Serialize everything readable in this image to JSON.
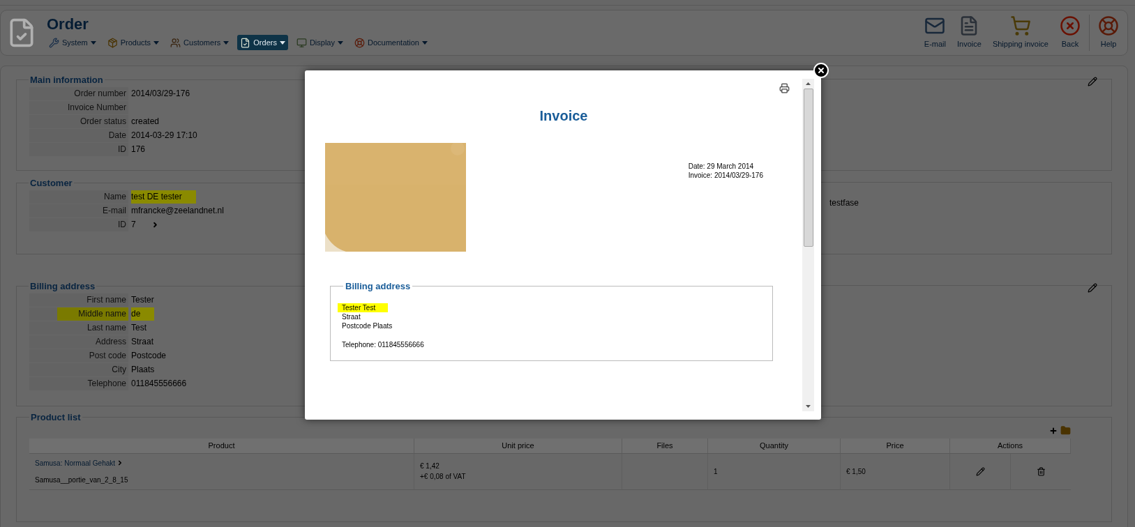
{
  "header": {
    "title": "Order",
    "menu": [
      {
        "label": "System",
        "selected": false
      },
      {
        "label": "Products",
        "selected": false
      },
      {
        "label": "Customers",
        "selected": false
      },
      {
        "label": "Orders",
        "selected": true
      },
      {
        "label": "Display",
        "selected": false
      },
      {
        "label": "Documentation",
        "selected": false
      }
    ],
    "toolbar": [
      "E-mail",
      "Invoice",
      "Shipping invoice",
      "Back",
      "Help"
    ]
  },
  "sections": [
    {
      "title": "Main information",
      "editable": true,
      "rows": [
        {
          "label": "Order number",
          "value": "2014/03/29-176",
          "kind": "text",
          "label_highlighted": false,
          "value_highlighted": false
        },
        {
          "label": "Invoice Number",
          "kind": "text",
          "label_highlighted": false
        },
        {
          "label": "Order status",
          "value": "created",
          "kind": "text",
          "label_highlighted": false,
          "value_highlighted": false
        },
        {
          "label": "Date",
          "value": "2014-03-29 17:10",
          "kind": "text",
          "label_highlighted": false,
          "value_highlighted": false
        },
        {
          "label": "ID",
          "value": "176",
          "kind": "text",
          "label_highlighted": false,
          "value_highlighted": false
        }
      ]
    },
    {
      "title": "Customer",
      "editable": false,
      "side_text": "testfase",
      "rows": [
        {
          "label": "Name",
          "value": "test DE tester",
          "kind": "text",
          "label_highlighted": false,
          "value_highlighted": true
        },
        {
          "label": "E-mail",
          "value": "mfrancke@zeelandnet.nl",
          "kind": "text",
          "label_highlighted": false,
          "value_highlighted": false
        },
        {
          "label": "ID",
          "value": "7",
          "kind": "link",
          "label_highlighted": false,
          "value_highlighted": false
        }
      ]
    },
    {
      "title": "Billing address",
      "editable": true,
      "rows": [
        {
          "label": "First name",
          "value": "Tester",
          "kind": "text",
          "label_highlighted": false,
          "value_highlighted": false
        },
        {
          "label": "Middle name",
          "value": "de",
          "kind": "text",
          "label_highlighted": true,
          "value_highlighted": true
        },
        {
          "label": "Last name",
          "value": "Test",
          "kind": "text",
          "label_highlighted": false,
          "value_highlighted": false
        },
        {
          "label": "Address",
          "value": "Straat",
          "kind": "text",
          "label_highlighted": false,
          "value_highlighted": false
        },
        {
          "label": "Post code",
          "value": "Postcode",
          "kind": "text",
          "label_highlighted": false,
          "value_highlighted": false
        },
        {
          "label": "City",
          "value": "Plaats",
          "kind": "text",
          "label_highlighted": false,
          "value_highlighted": false
        },
        {
          "label": "Telephone",
          "value": "011845556666",
          "kind": "text",
          "label_highlighted": false,
          "value_highlighted": false
        }
      ]
    }
  ],
  "product_list": {
    "title": "Product list",
    "columns": [
      "Product",
      "Unit price",
      "Files",
      "Quantity",
      "Price",
      "Actions"
    ],
    "rows": [
      {
        "product": "Samusa: Normaal Gehakt",
        "variant": "Samusa__portie_van_2_8_15",
        "unit_price": "€ 1,42",
        "vat": "+€ 0,08 of VAT",
        "quantity": "1",
        "price": "€ 1,50"
      }
    ]
  },
  "modal": {
    "title": "Invoice",
    "date": "Date: 29 March 2014",
    "invoice": "Invoice: 2014/03/29-176",
    "billing": {
      "title": "Billing address",
      "lines": [
        {
          "text": "Tester Test",
          "highlighted": true
        },
        {
          "text": "Straat",
          "highlighted": false
        },
        {
          "text": "Postcode Plaats",
          "highlighted": false
        }
      ],
      "telephone": "Telephone: 011845556666"
    }
  }
}
